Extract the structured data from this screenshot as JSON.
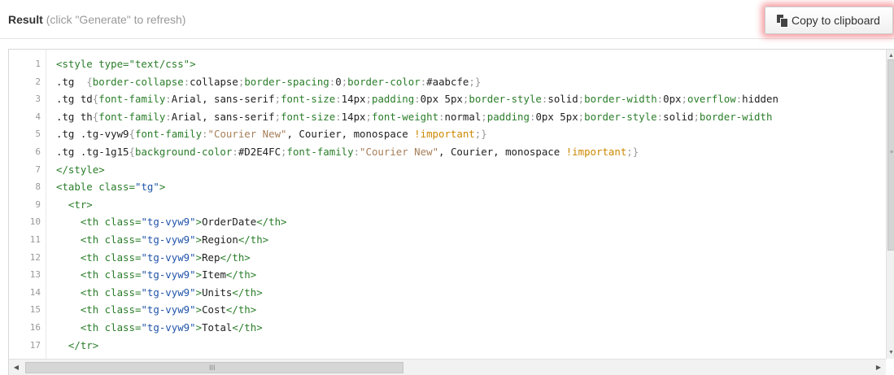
{
  "header": {
    "title": "Result",
    "hint": "(click \"Generate\" to refresh)",
    "copy_button_label": "Copy to clipboard",
    "copy_icon": "copy-icon"
  },
  "editor": {
    "line_numbers": [
      "1",
      "2",
      "3",
      "4",
      "5",
      "6",
      "7",
      "8",
      "9",
      "10",
      "11",
      "12",
      "13",
      "14",
      "15",
      "16",
      "17"
    ],
    "lines": [
      [
        {
          "t": "tag",
          "s": "<style type=\"text/css\">"
        }
      ],
      [
        {
          "t": "plain",
          "s": ".tg  "
        },
        {
          "t": "punct",
          "s": "{"
        },
        {
          "t": "prop",
          "s": "border-collapse"
        },
        {
          "t": "punct",
          "s": ":"
        },
        {
          "t": "plain",
          "s": "collapse"
        },
        {
          "t": "punct",
          "s": ";"
        },
        {
          "t": "prop",
          "s": "border-spacing"
        },
        {
          "t": "punct",
          "s": ":"
        },
        {
          "t": "plain",
          "s": "0"
        },
        {
          "t": "punct",
          "s": ";"
        },
        {
          "t": "prop",
          "s": "border-color"
        },
        {
          "t": "punct",
          "s": ":"
        },
        {
          "t": "plain",
          "s": "#aabcfe"
        },
        {
          "t": "punct",
          "s": ";}"
        }
      ],
      [
        {
          "t": "plain",
          "s": ".tg td"
        },
        {
          "t": "punct",
          "s": "{"
        },
        {
          "t": "prop",
          "s": "font-family"
        },
        {
          "t": "punct",
          "s": ":"
        },
        {
          "t": "plain",
          "s": "Arial, sans-serif"
        },
        {
          "t": "punct",
          "s": ";"
        },
        {
          "t": "prop",
          "s": "font-size"
        },
        {
          "t": "punct",
          "s": ":"
        },
        {
          "t": "plain",
          "s": "14px"
        },
        {
          "t": "punct",
          "s": ";"
        },
        {
          "t": "prop",
          "s": "padding"
        },
        {
          "t": "punct",
          "s": ":"
        },
        {
          "t": "plain",
          "s": "0px 5px"
        },
        {
          "t": "punct",
          "s": ";"
        },
        {
          "t": "prop",
          "s": "border-style"
        },
        {
          "t": "punct",
          "s": ":"
        },
        {
          "t": "plain",
          "s": "solid"
        },
        {
          "t": "punct",
          "s": ";"
        },
        {
          "t": "prop",
          "s": "border-width"
        },
        {
          "t": "punct",
          "s": ":"
        },
        {
          "t": "plain",
          "s": "0px"
        },
        {
          "t": "punct",
          "s": ";"
        },
        {
          "t": "prop",
          "s": "overflow"
        },
        {
          "t": "punct",
          "s": ":"
        },
        {
          "t": "plain",
          "s": "hidden"
        }
      ],
      [
        {
          "t": "plain",
          "s": ".tg th"
        },
        {
          "t": "punct",
          "s": "{"
        },
        {
          "t": "prop",
          "s": "font-family"
        },
        {
          "t": "punct",
          "s": ":"
        },
        {
          "t": "plain",
          "s": "Arial, sans-serif"
        },
        {
          "t": "punct",
          "s": ";"
        },
        {
          "t": "prop",
          "s": "font-size"
        },
        {
          "t": "punct",
          "s": ":"
        },
        {
          "t": "plain",
          "s": "14px"
        },
        {
          "t": "punct",
          "s": ";"
        },
        {
          "t": "prop",
          "s": "font-weight"
        },
        {
          "t": "punct",
          "s": ":"
        },
        {
          "t": "plain",
          "s": "normal"
        },
        {
          "t": "punct",
          "s": ";"
        },
        {
          "t": "prop",
          "s": "padding"
        },
        {
          "t": "punct",
          "s": ":"
        },
        {
          "t": "plain",
          "s": "0px 5px"
        },
        {
          "t": "punct",
          "s": ";"
        },
        {
          "t": "prop",
          "s": "border-style"
        },
        {
          "t": "punct",
          "s": ":"
        },
        {
          "t": "plain",
          "s": "solid"
        },
        {
          "t": "punct",
          "s": ";"
        },
        {
          "t": "prop",
          "s": "border-width"
        }
      ],
      [
        {
          "t": "plain",
          "s": ".tg .tg-vyw9"
        },
        {
          "t": "punct",
          "s": "{"
        },
        {
          "t": "prop",
          "s": "font-family"
        },
        {
          "t": "punct",
          "s": ":"
        },
        {
          "t": "str",
          "s": "\"Courier New\""
        },
        {
          "t": "plain",
          "s": ", Courier, monospace "
        },
        {
          "t": "imp",
          "s": "!important"
        },
        {
          "t": "punct",
          "s": ";}"
        }
      ],
      [
        {
          "t": "plain",
          "s": ".tg .tg-1g15"
        },
        {
          "t": "punct",
          "s": "{"
        },
        {
          "t": "prop",
          "s": "background-color"
        },
        {
          "t": "punct",
          "s": ":"
        },
        {
          "t": "plain",
          "s": "#D2E4FC"
        },
        {
          "t": "punct",
          "s": ";"
        },
        {
          "t": "prop",
          "s": "font-family"
        },
        {
          "t": "punct",
          "s": ":"
        },
        {
          "t": "str",
          "s": "\"Courier New\""
        },
        {
          "t": "plain",
          "s": ", Courier, monospace "
        },
        {
          "t": "imp",
          "s": "!important"
        },
        {
          "t": "punct",
          "s": ";}"
        }
      ],
      [
        {
          "t": "tag",
          "s": "</style>"
        }
      ],
      [
        {
          "t": "tag",
          "s": "<table class="
        },
        {
          "t": "val",
          "s": "\"tg\""
        },
        {
          "t": "tag",
          "s": ">"
        }
      ],
      [
        {
          "t": "plain",
          "s": "  "
        },
        {
          "t": "tag",
          "s": "<tr>"
        }
      ],
      [
        {
          "t": "plain",
          "s": "    "
        },
        {
          "t": "tag",
          "s": "<th class="
        },
        {
          "t": "val",
          "s": "\"tg-vyw9\""
        },
        {
          "t": "tag",
          "s": ">"
        },
        {
          "t": "plain",
          "s": "OrderDate"
        },
        {
          "t": "tag",
          "s": "</th>"
        }
      ],
      [
        {
          "t": "plain",
          "s": "    "
        },
        {
          "t": "tag",
          "s": "<th class="
        },
        {
          "t": "val",
          "s": "\"tg-vyw9\""
        },
        {
          "t": "tag",
          "s": ">"
        },
        {
          "t": "plain",
          "s": "Region"
        },
        {
          "t": "tag",
          "s": "</th>"
        }
      ],
      [
        {
          "t": "plain",
          "s": "    "
        },
        {
          "t": "tag",
          "s": "<th class="
        },
        {
          "t": "val",
          "s": "\"tg-vyw9\""
        },
        {
          "t": "tag",
          "s": ">"
        },
        {
          "t": "plain",
          "s": "Rep"
        },
        {
          "t": "tag",
          "s": "</th>"
        }
      ],
      [
        {
          "t": "plain",
          "s": "    "
        },
        {
          "t": "tag",
          "s": "<th class="
        },
        {
          "t": "val",
          "s": "\"tg-vyw9\""
        },
        {
          "t": "tag",
          "s": ">"
        },
        {
          "t": "plain",
          "s": "Item"
        },
        {
          "t": "tag",
          "s": "</th>"
        }
      ],
      [
        {
          "t": "plain",
          "s": "    "
        },
        {
          "t": "tag",
          "s": "<th class="
        },
        {
          "t": "val",
          "s": "\"tg-vyw9\""
        },
        {
          "t": "tag",
          "s": ">"
        },
        {
          "t": "plain",
          "s": "Units"
        },
        {
          "t": "tag",
          "s": "</th>"
        }
      ],
      [
        {
          "t": "plain",
          "s": "    "
        },
        {
          "t": "tag",
          "s": "<th class="
        },
        {
          "t": "val",
          "s": "\"tg-vyw9\""
        },
        {
          "t": "tag",
          "s": ">"
        },
        {
          "t": "plain",
          "s": "Cost"
        },
        {
          "t": "tag",
          "s": "</th>"
        }
      ],
      [
        {
          "t": "plain",
          "s": "    "
        },
        {
          "t": "tag",
          "s": "<th class="
        },
        {
          "t": "val",
          "s": "\"tg-vyw9\""
        },
        {
          "t": "tag",
          "s": ">"
        },
        {
          "t": "plain",
          "s": "Total"
        },
        {
          "t": "tag",
          "s": "</th>"
        }
      ],
      [
        {
          "t": "plain",
          "s": "  "
        },
        {
          "t": "tag",
          "s": "</tr>"
        }
      ]
    ]
  },
  "scrollbars": {
    "vertical_icon": "scrollbar-grip-icon",
    "horizontal_icon": "scrollbar-grip-icon",
    "grip_glyph": "III"
  }
}
